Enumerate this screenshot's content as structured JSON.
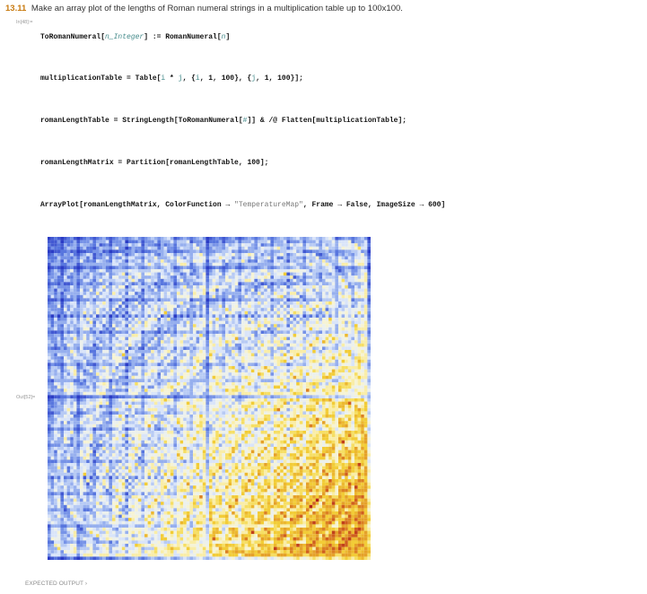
{
  "exercise": {
    "number": "13.11",
    "text": "Make an array plot of the lengths of Roman numeral strings in a multiplication table up to 100x100."
  },
  "labels": {
    "input": "In[48]:=",
    "output": "Out[52]="
  },
  "code": {
    "line1": {
      "head": "ToRomanNumeral[",
      "pattern": "n_Integer",
      "mid": "] := RomanNumeral[",
      "arg": "n",
      "tail": "]"
    },
    "line2": {
      "head": "multiplicationTable = Table[",
      "i1": "i",
      "op": " ",
      "star": "*",
      "j1": " j",
      "mid1": ", {",
      "i2": "i",
      "mid2": ", 1, 100}, {",
      "j2": "j",
      "tail": ", 1, 100}];"
    },
    "line3": {
      "head": "romanLengthTable = StringLength[ToRomanNumeral[",
      "slot": "#",
      "tail": "]] & /@ Flatten[multiplicationTable];"
    },
    "line4": "romanLengthMatrix = Partition[romanLengthTable, 100];",
    "line5": {
      "head": "ArrayPlot[romanLengthMatrix, ColorFunction → ",
      "str": "\"TemperatureMap\"",
      "tail": ", Frame → False, ImageSize → 600]"
    }
  },
  "footer": "EXPECTED OUTPUT ›",
  "colors": {
    "exercise_number": "#c87a0f",
    "code_text": "#111111",
    "code_symbol": "#438a8a",
    "code_string": "#777777",
    "label": "#9a9a9a",
    "temperature_map": [
      "#2b3cc5",
      "#5b7ae0",
      "#9eb6f0",
      "#e6eefb",
      "#fbf5c8",
      "#f4d43a",
      "#e8a92a",
      "#d2631e",
      "#b2221a"
    ]
  },
  "chart_data": {
    "type": "heatmap",
    "rows": 100,
    "cols": 100,
    "value": "StringLength of the Roman numeral for i*j, i and j from 1 to 100",
    "color_function": "TemperatureMap",
    "frame": false
  }
}
